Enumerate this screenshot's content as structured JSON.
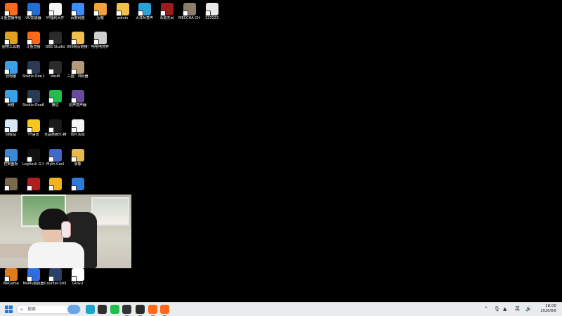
{
  "desktop": {
    "icons": [
      {
        "label": "斗鱼直播伴侣",
        "icon": "douyu-app-icon",
        "color": "#ff6a1a"
      },
      {
        "label": "UU加速器",
        "icon": "uu-accelerator-icon",
        "color": "#1f6fd6"
      },
      {
        "label": "YY福利大厅",
        "icon": "document-icon",
        "color": "#f4f4f4"
      },
      {
        "label": "百度网盘",
        "icon": "baidu-netdisk-icon",
        "color": "#3b8cff"
      },
      {
        "label": "压缩",
        "icon": "compress-icon",
        "color": "#f2a23a"
      },
      {
        "label": "admin",
        "icon": "folder-icon",
        "color": "#f3c14b"
      },
      {
        "label": "大洋AI变声",
        "icon": "voice-changer-icon",
        "color": "#2aa4d8"
      },
      {
        "label": "永劫无间",
        "icon": "naraka-game-icon",
        "color": "#9c1b1b"
      },
      {
        "label": "MECCHA CHAMELE...",
        "icon": "meccha-chameleon-icon",
        "color": "#8a7d6a"
      },
      {
        "label": "123123",
        "icon": "qr-code-icon",
        "color": "#e8e8e8"
      },
      {
        "label": "图吧工具箱",
        "icon": "tuba-toolbox-icon",
        "color": "#e0a020"
      },
      {
        "label": "斗鱼直播",
        "icon": "douyu-live-icon",
        "color": "#ff6a1a"
      },
      {
        "label": "OBS Studio",
        "icon": "obs-icon",
        "color": "#2b2b2b"
      },
      {
        "label": "000网页链接文件夹失...",
        "icon": "folder-icon",
        "color": "#f3c14b"
      },
      {
        "label": "哈哈电竞杯",
        "icon": "image-file-icon",
        "color": "#cfcfcf"
      },
      {
        "label": "此电脑",
        "icon": "this-pc-icon",
        "color": "#3aa0e8"
      },
      {
        "label": "Studio One 6",
        "icon": "studio-one-icon",
        "color": "#2a3a55"
      },
      {
        "label": "obsM",
        "icon": "obs-icon",
        "color": "#2b2b2b"
      },
      {
        "label": "三国：归利器",
        "icon": "sanguo-game-icon",
        "color": "#b49a7a"
      },
      {
        "label": "网络",
        "icon": "network-icon",
        "color": "#3aa0e8"
      },
      {
        "label": "Studio One6 一键安装包",
        "icon": "studio-one-icon",
        "color": "#2a3a55"
      },
      {
        "label": "微信",
        "icon": "wechat-icon",
        "color": "#1fbf4b"
      },
      {
        "label": "原声变声器",
        "icon": "voice-changer-icon",
        "color": "#6a4a9a"
      },
      {
        "label": "回收站",
        "icon": "recycle-bin-icon",
        "color": "#d8e8f5"
      },
      {
        "label": "YY语音",
        "icon": "yy-voice-icon",
        "color": "#f5c81e"
      },
      {
        "label": "全品类娱乐-精粹电竞",
        "icon": "esports-icon",
        "color": "#1a1a1a"
      },
      {
        "label": "切片活动",
        "icon": "document-icon",
        "color": "#f4f4f4"
      },
      {
        "label": "控制面板",
        "icon": "control-panel-icon",
        "color": "#3a8ad8"
      },
      {
        "label": "Logitech G HUB",
        "icon": "logitech-ghub-icon",
        "color": "#111111"
      },
      {
        "label": "Myth.Cool",
        "icon": "myth-cool-icon",
        "color": "#3f6bc7"
      },
      {
        "label": "录像",
        "icon": "video-folder-icon",
        "color": "#e9b84a"
      },
      {
        "label": "",
        "icon": "pubg-game-icon",
        "color": "#7a6a4a"
      },
      {
        "label": "",
        "icon": "dota2-game-icon",
        "color": "#b21e1e"
      },
      {
        "label": "",
        "icon": "game-launcher-icon",
        "color": "#f0b31e"
      },
      {
        "label": "",
        "icon": "game-app-icon",
        "color": "#2b7bd8"
      },
      {
        "label": "WeGame",
        "icon": "wegame-icon",
        "color": "#e07a1a"
      },
      {
        "label": "MuMu模拟器",
        "icon": "mumu-emulator-icon",
        "color": "#2d6de0"
      },
      {
        "label": "Counter-Strike 2",
        "icon": "cs2-icon",
        "color": "#2a3f6a"
      },
      {
        "label": "GUGU",
        "icon": "gugu-app-icon",
        "color": "#ffffff"
      }
    ]
  },
  "taskbar": {
    "start_icon": "windows-start-icon",
    "search_placeholder": "搜索",
    "search_icon": "search-icon",
    "apps": [
      {
        "icon": "widgets-icon",
        "color": "#6aa5e8"
      },
      {
        "icon": "edge-browser-icon",
        "color": "#1fa3c7"
      },
      {
        "icon": "terminal-icon",
        "color": "#2f2f2f"
      },
      {
        "icon": "wechat-icon",
        "color": "#1fbf4b"
      },
      {
        "icon": "media-player-icon",
        "color": "#333333"
      },
      {
        "icon": "obs-icon",
        "color": "#2b2b2b"
      },
      {
        "icon": "douyu-app-icon",
        "color": "#ff6a1a"
      },
      {
        "icon": "douyu-live-icon",
        "color": "#ff6a1a"
      }
    ],
    "tray": {
      "chevron": "^",
      "ime": "英",
      "time": "18:00",
      "date": "2026/8/8"
    }
  }
}
